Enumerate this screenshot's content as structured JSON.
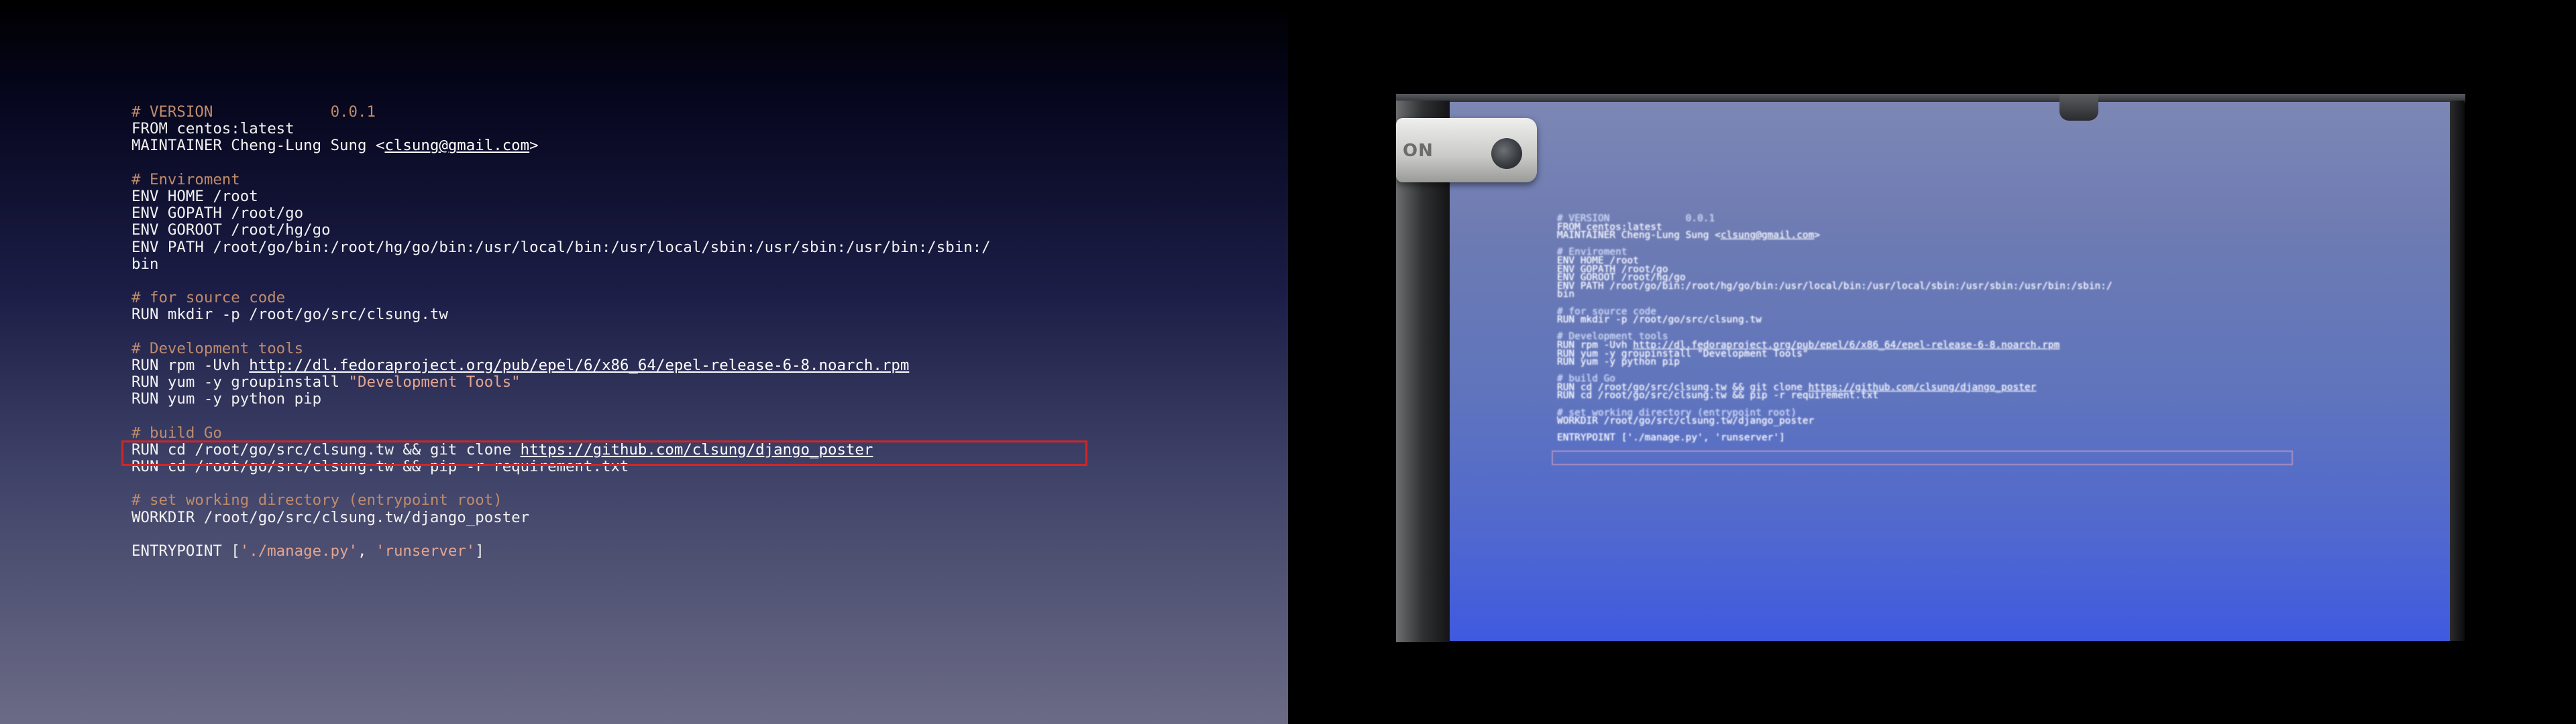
{
  "slide": {
    "lines": [
      {
        "type": "comment",
        "text": "# VERSION             0.0.1"
      },
      {
        "type": "code",
        "text": "FROM centos:latest"
      },
      {
        "type": "code-with-link",
        "before": "MAINTAINER Cheng-Lung Sung <",
        "link": "clsung@gmail.com",
        "after": ">"
      },
      {
        "type": "blank"
      },
      {
        "type": "comment",
        "text": "# Enviroment"
      },
      {
        "type": "code",
        "text": "ENV HOME /root"
      },
      {
        "type": "code",
        "text": "ENV GOPATH /root/go"
      },
      {
        "type": "code",
        "text": "ENV GOROOT /root/hg/go"
      },
      {
        "type": "code",
        "text": "ENV PATH /root/go/bin:/root/hg/go/bin:/usr/local/bin:/usr/local/sbin:/usr/sbin:/usr/bin:/sbin:/"
      },
      {
        "type": "code",
        "text": "bin"
      },
      {
        "type": "blank"
      },
      {
        "type": "comment",
        "text": "# for source code"
      },
      {
        "type": "code",
        "text": "RUN mkdir -p /root/go/src/clsung.tw"
      },
      {
        "type": "blank"
      },
      {
        "type": "comment",
        "text": "# Development tools"
      },
      {
        "type": "code-with-link",
        "before": "RUN rpm -Uvh ",
        "link": "http://dl.fedoraproject.org/pub/epel/6/x86_64/epel-release-6-8.noarch.rpm",
        "after": ""
      },
      {
        "type": "code-with-string",
        "before": "RUN yum -y groupinstall ",
        "str": "\"Development Tools\"",
        "after": ""
      },
      {
        "type": "code",
        "text": "RUN yum -y python pip"
      },
      {
        "type": "blank"
      },
      {
        "type": "comment",
        "text": "# build Go"
      },
      {
        "type": "code-with-link",
        "before": "RUN cd /root/go/src/clsung.tw && git clone ",
        "link": "https://github.com/clsung/django_poster",
        "after": ""
      },
      {
        "type": "code",
        "text": "RUN cd /root/go/src/clsung.tw && pip -r requirement.txt"
      },
      {
        "type": "blank"
      },
      {
        "type": "comment",
        "text": "# set working directory (entrypoint root)"
      },
      {
        "type": "code",
        "text": "WORKDIR /root/go/src/clsung.tw/django_poster"
      },
      {
        "type": "blank"
      },
      {
        "type": "entrypoint",
        "before": "ENTRYPOINT [",
        "s1": "'./manage.py'",
        "mid": ", ",
        "s2": "'runserver'",
        "after": "]"
      }
    ]
  },
  "photo": {
    "projector_label": "ON",
    "screen_lines": [
      {
        "type": "comment",
        "text": "# VERSION             0.0.1"
      },
      {
        "type": "code",
        "text": "FROM centos:latest"
      },
      {
        "type": "code-with-link",
        "before": "MAINTAINER Cheng-Lung Sung <",
        "link": "clsung@gmail.com",
        "after": ">"
      },
      {
        "type": "blank"
      },
      {
        "type": "comment",
        "text": "# Enviroment"
      },
      {
        "type": "code",
        "text": "ENV HOME /root"
      },
      {
        "type": "code",
        "text": "ENV GOPATH /root/go"
      },
      {
        "type": "code",
        "text": "ENV GOROOT /root/hg/go"
      },
      {
        "type": "code",
        "text": "ENV PATH /root/go/bin:/root/hg/go/bin:/usr/local/bin:/usr/local/sbin:/usr/sbin:/usr/bin:/sbin:/"
      },
      {
        "type": "code",
        "text": "bin"
      },
      {
        "type": "blank"
      },
      {
        "type": "comment",
        "text": "# for source code"
      },
      {
        "type": "code",
        "text": "RUN mkdir -p /root/go/src/clsung.tw"
      },
      {
        "type": "blank"
      },
      {
        "type": "comment",
        "text": "# Development tools"
      },
      {
        "type": "code-with-link",
        "before": "RUN rpm -Uvh ",
        "link": "http://dl.fedoraproject.org/pub/epel/6/x86_64/epel-release-6-8.noarch.rpm",
        "after": ""
      },
      {
        "type": "code-with-string",
        "before": "RUN yum -y groupinstall ",
        "str": "\"Development Tools\"",
        "after": ""
      },
      {
        "type": "code",
        "text": "RUN yum -y python pip"
      },
      {
        "type": "blank"
      },
      {
        "type": "comment",
        "text": "# build Go"
      },
      {
        "type": "code-with-link",
        "before": "RUN cd /root/go/src/clsung.tw && git clone ",
        "link": "https://github.com/clsung/django_poster",
        "after": ""
      },
      {
        "type": "code",
        "text": "RUN cd /root/go/src/clsung.tw && pip -r requirement.txt"
      },
      {
        "type": "blank"
      },
      {
        "type": "comment",
        "text": "# set working directory (entrypoint root)"
      },
      {
        "type": "code",
        "text": "WORKDIR /root/go/src/clsung.tw/django_poster"
      },
      {
        "type": "blank"
      },
      {
        "type": "entrypoint",
        "before": "ENTRYPOINT [",
        "s1": "'./manage.py'",
        "mid": ", ",
        "s2": "'runserver'",
        "after": "]"
      }
    ]
  },
  "colors": {
    "comment": "#c08b6b",
    "string": "#e4a58f",
    "highlight_box": "#d12626",
    "screen_blue": "#5068cf"
  }
}
